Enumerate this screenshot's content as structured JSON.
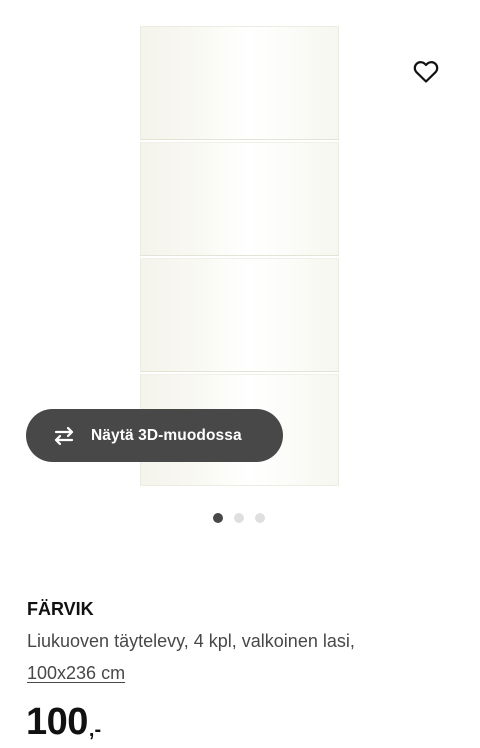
{
  "gallery": {
    "view3d_label": "Näytä 3D-muodossa",
    "view3d_icon": "rotate-3d-icon",
    "favourite_icon": "heart-icon",
    "page_count": 3,
    "active_page": 1
  },
  "product": {
    "name": "FÄRVIK",
    "description": "Liukuoven täytelevy, 4 kpl, valkoinen lasi,",
    "size": "100x236 cm",
    "price_integer": "100",
    "price_suffix": ",-"
  },
  "colors": {
    "button_bg": "#484848",
    "text_primary": "#111111",
    "text_secondary": "#484848",
    "dot_active": "#484848",
    "dot_inactive": "#dfdfdf"
  }
}
